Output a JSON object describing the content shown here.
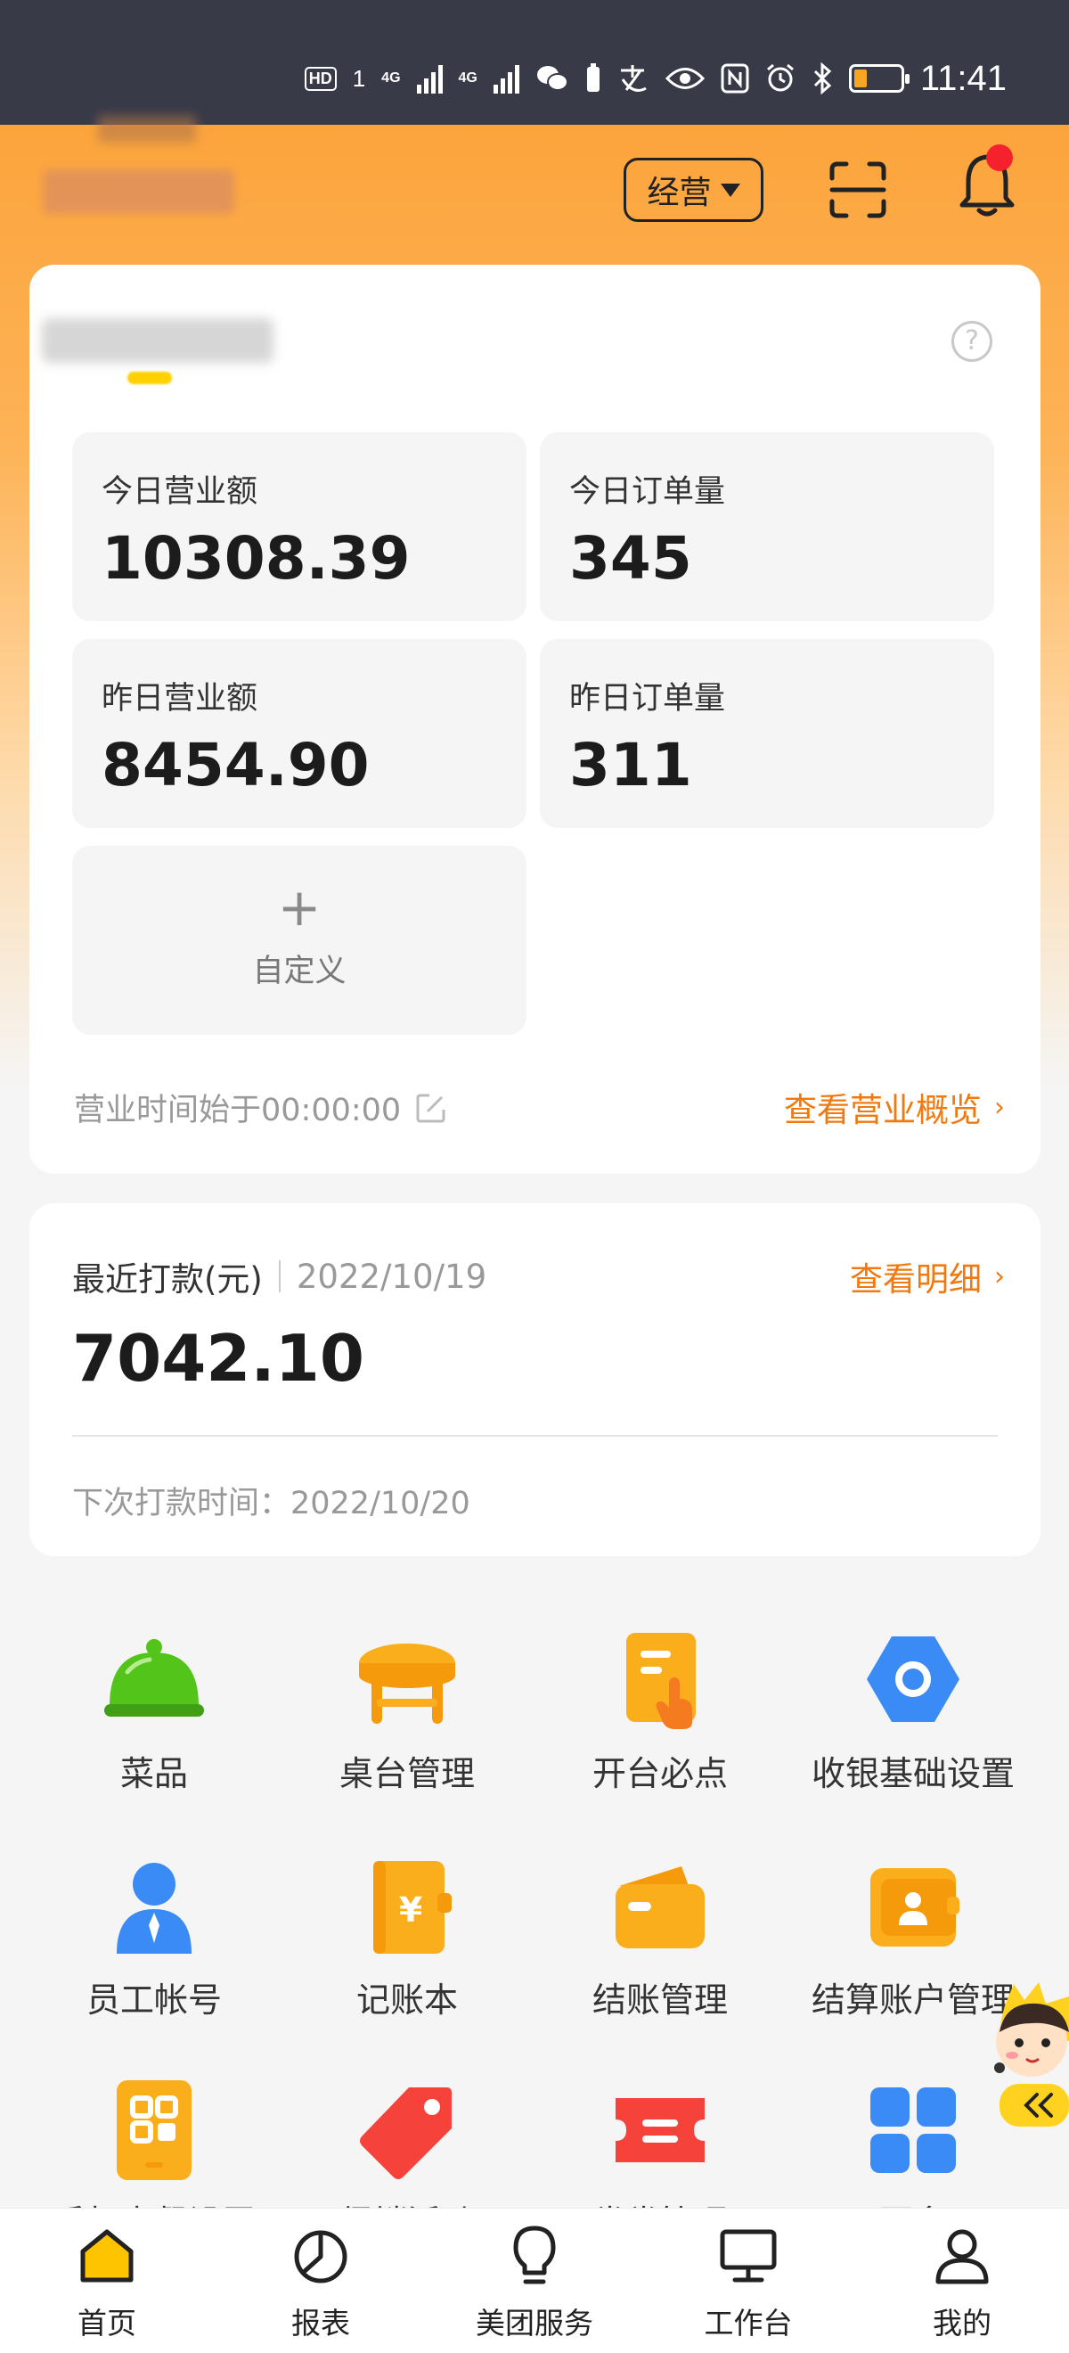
{
  "status_bar": {
    "hd": "HD",
    "sim1": "1",
    "net1": "4G",
    "net2": "4G",
    "time": "11:41"
  },
  "header": {
    "mode_label": "经营",
    "has_notification": true
  },
  "overview_card": {
    "stats": [
      {
        "label": "今日营业额",
        "value": "10308.39"
      },
      {
        "label": "今日订单量",
        "value": "345"
      },
      {
        "label": "昨日营业额",
        "value": "8454.90"
      },
      {
        "label": "昨日订单量",
        "value": "311"
      }
    ],
    "custom_plus": "+",
    "custom_label": "自定义",
    "business_time": "营业时间始于00:00:00",
    "overview_link": "查看营业概览"
  },
  "payout_card": {
    "label": "最近打款(元)",
    "date": "2022/10/19",
    "amount": "7042.10",
    "detail_link": "查看明细",
    "next_payout": "下次打款时间：2022/10/20"
  },
  "grid": [
    {
      "label": "菜品",
      "icon": "dish-cover-icon"
    },
    {
      "label": "桌台管理",
      "icon": "table-icon"
    },
    {
      "label": "开台必点",
      "icon": "order-tap-icon"
    },
    {
      "label": "收银基础设置",
      "icon": "hexagon-settings-icon"
    },
    {
      "label": "员工帐号",
      "icon": "staff-icon"
    },
    {
      "label": "记账本",
      "icon": "ledger-icon"
    },
    {
      "label": "结账管理",
      "icon": "wallet-icon"
    },
    {
      "label": "结算账户管理",
      "icon": "account-wallet-icon"
    },
    {
      "label": "手机点餐设置",
      "icon": "qr-phone-icon"
    },
    {
      "label": "促销活动",
      "icon": "price-tag-icon"
    },
    {
      "label": "券券管理",
      "icon": "coupon-icon"
    },
    {
      "label": "更多",
      "icon": "more-grid-icon"
    }
  ],
  "bottom_nav": [
    {
      "label": "首页",
      "icon": "home-icon",
      "active": true
    },
    {
      "label": "报表",
      "icon": "chart-icon"
    },
    {
      "label": "美团服务",
      "icon": "bulb-icon"
    },
    {
      "label": "工作台",
      "icon": "monitor-icon"
    },
    {
      "label": "我的",
      "icon": "profile-icon"
    }
  ],
  "colors": {
    "brand_orange": "#fca43c",
    "link_orange": "#f07a10",
    "notification_red": "#f5222d"
  }
}
